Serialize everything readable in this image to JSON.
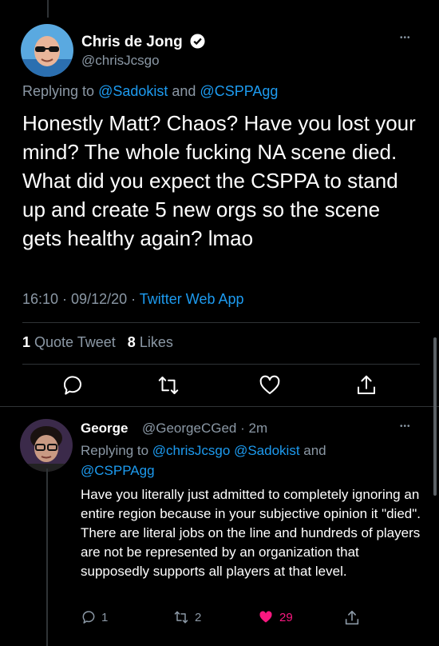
{
  "tweet": {
    "author_name": "Chris de Jong",
    "author_handle": "@chrisJcsgo",
    "more_label": "•••",
    "replying_prefix": "Replying to ",
    "replying_to_1": "@Sadokist",
    "replying_and": " and ",
    "replying_to_2": "@CSPPAgg",
    "text": "Honestly Matt? Chaos? Have you lost your mind? The whole fucking NA scene died. What did you expect the CSPPA to stand up and create 5 new orgs so the scene gets healthy again? lmao",
    "time": "16:10",
    "dot": " · ",
    "date": "09/12/20",
    "source": "Twitter Web App",
    "quote_count": "1",
    "quote_label": "Quote Tweet",
    "like_count": "8",
    "like_label": "Likes"
  },
  "reply": {
    "author_name": "George",
    "author_handle": "@GeorgeCGed",
    "age": "2m",
    "replying_prefix": "Replying to ",
    "replying_to_1": "@chrisJcsgo",
    "replying_to_2": "@Sadokist",
    "replying_and": " and ",
    "replying_to_3": "@CSPPAgg",
    "text": "Have you literally just admitted to completely ignoring an entire region because in your subjective opinion it \"died\". There are literal jobs on the line and hundreds of players are not be represented by an organization that supposedly supports all players at that level.",
    "reply_count": "1",
    "retweet_count": "2",
    "like_count": "29"
  },
  "colors": {
    "accent": "#1d9bf0",
    "verified": "#ffffff",
    "like_active": "#f91880",
    "secondary_text": "#8b98a5"
  },
  "icons": [
    "verified-badge-icon",
    "more-icon",
    "reply-icon",
    "retweet-icon",
    "like-icon",
    "share-icon"
  ]
}
